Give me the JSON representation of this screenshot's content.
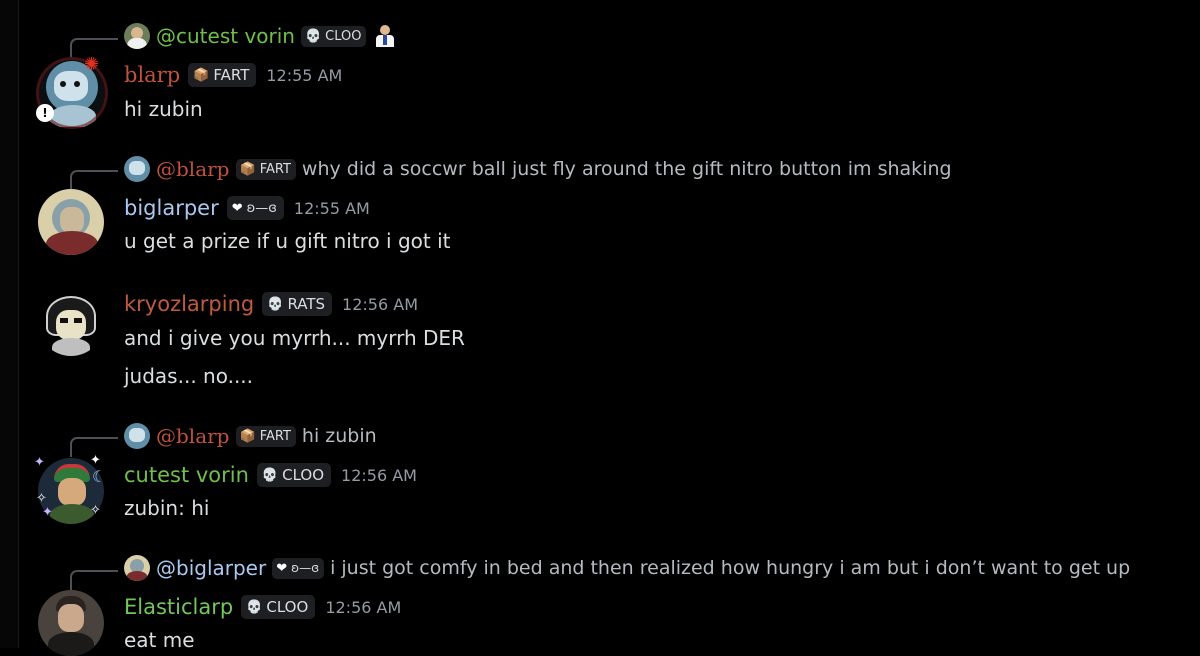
{
  "colors": {
    "blarp": "#c0523a",
    "biglarper": "#a9c9f0",
    "kryozlarping": "#c05a3e",
    "cutest_vorin": "#6fbf4a",
    "elasticlarp": "#72c65c",
    "background": "#000000",
    "timestamp": "#949ba4"
  },
  "messages": [
    {
      "reply": {
        "mention": "@cutest vorin",
        "tag_icon": "skull-icon",
        "tag": "CLOO",
        "text": "",
        "extra_icon": "person-emoji-icon"
      },
      "author": "blarp",
      "tag_icon": "box-icon",
      "tag": "FART",
      "time": "12:55 AM",
      "lines": [
        "hi zubin"
      ]
    },
    {
      "reply": {
        "mention": "@blarp",
        "tag_icon": "box-icon",
        "tag": "FART",
        "text": "why did a soccwr ball just fly around the gift nitro button im shaking"
      },
      "author": "biglarper",
      "tag_icon": "heart-icon",
      "tag": "ʚ—ɞ",
      "time": "12:55 AM",
      "lines": [
        "u get a prize if u gift nitro i got it"
      ]
    },
    {
      "author": "kryozlarping",
      "tag_icon": "skull-icon",
      "tag": "RATS",
      "time": "12:56 AM",
      "lines": [
        "and i give you myrrh... myrrh DER",
        "judas... no...."
      ]
    },
    {
      "reply": {
        "mention": "@blarp",
        "tag_icon": "box-icon",
        "tag": "FART",
        "text": "hi zubin"
      },
      "author": "cutest vorin",
      "tag_icon": "skull-icon",
      "tag": "CLOO",
      "time": "12:56 AM",
      "lines": [
        "zubin: hi"
      ]
    },
    {
      "reply": {
        "mention": "@biglarper",
        "tag_icon": "heart-icon",
        "tag": "ʚ—ɞ",
        "text": "i just got comfy in bed and then realized how hungry i am but i don’t want to get up"
      },
      "author": "Elasticlarp",
      "tag_icon": "skull-icon",
      "tag": "CLOO",
      "time": "12:56 AM",
      "lines": [
        "eat me"
      ]
    }
  ]
}
